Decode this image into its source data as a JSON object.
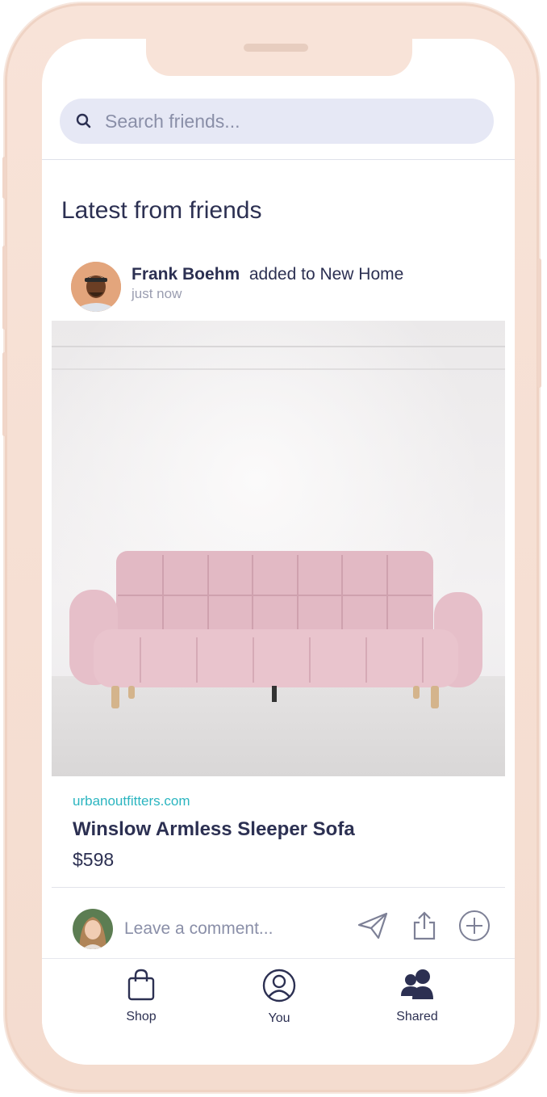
{
  "search": {
    "placeholder": "Search friends..."
  },
  "feed": {
    "section_title": "Latest from friends",
    "post": {
      "author": "Frank Boehm",
      "action": "added to New Home",
      "time": "just now",
      "source": "urbanoutfitters.com",
      "product_name": "Winslow Armless Sleeper Sofa",
      "price": "$598"
    },
    "comment": {
      "placeholder": "Leave a comment..."
    }
  },
  "tabs": [
    {
      "label": "Shop",
      "icon": "shopping-bag-icon"
    },
    {
      "label": "You",
      "icon": "user-circle-icon"
    },
    {
      "label": "Shared",
      "icon": "users-icon"
    }
  ],
  "colors": {
    "accent_text": "#2c3052",
    "link": "#2bb5c0",
    "search_bg": "#e6e8f5",
    "phone_frame": "#f8e3d8",
    "sofa": "#e4bcc6"
  }
}
